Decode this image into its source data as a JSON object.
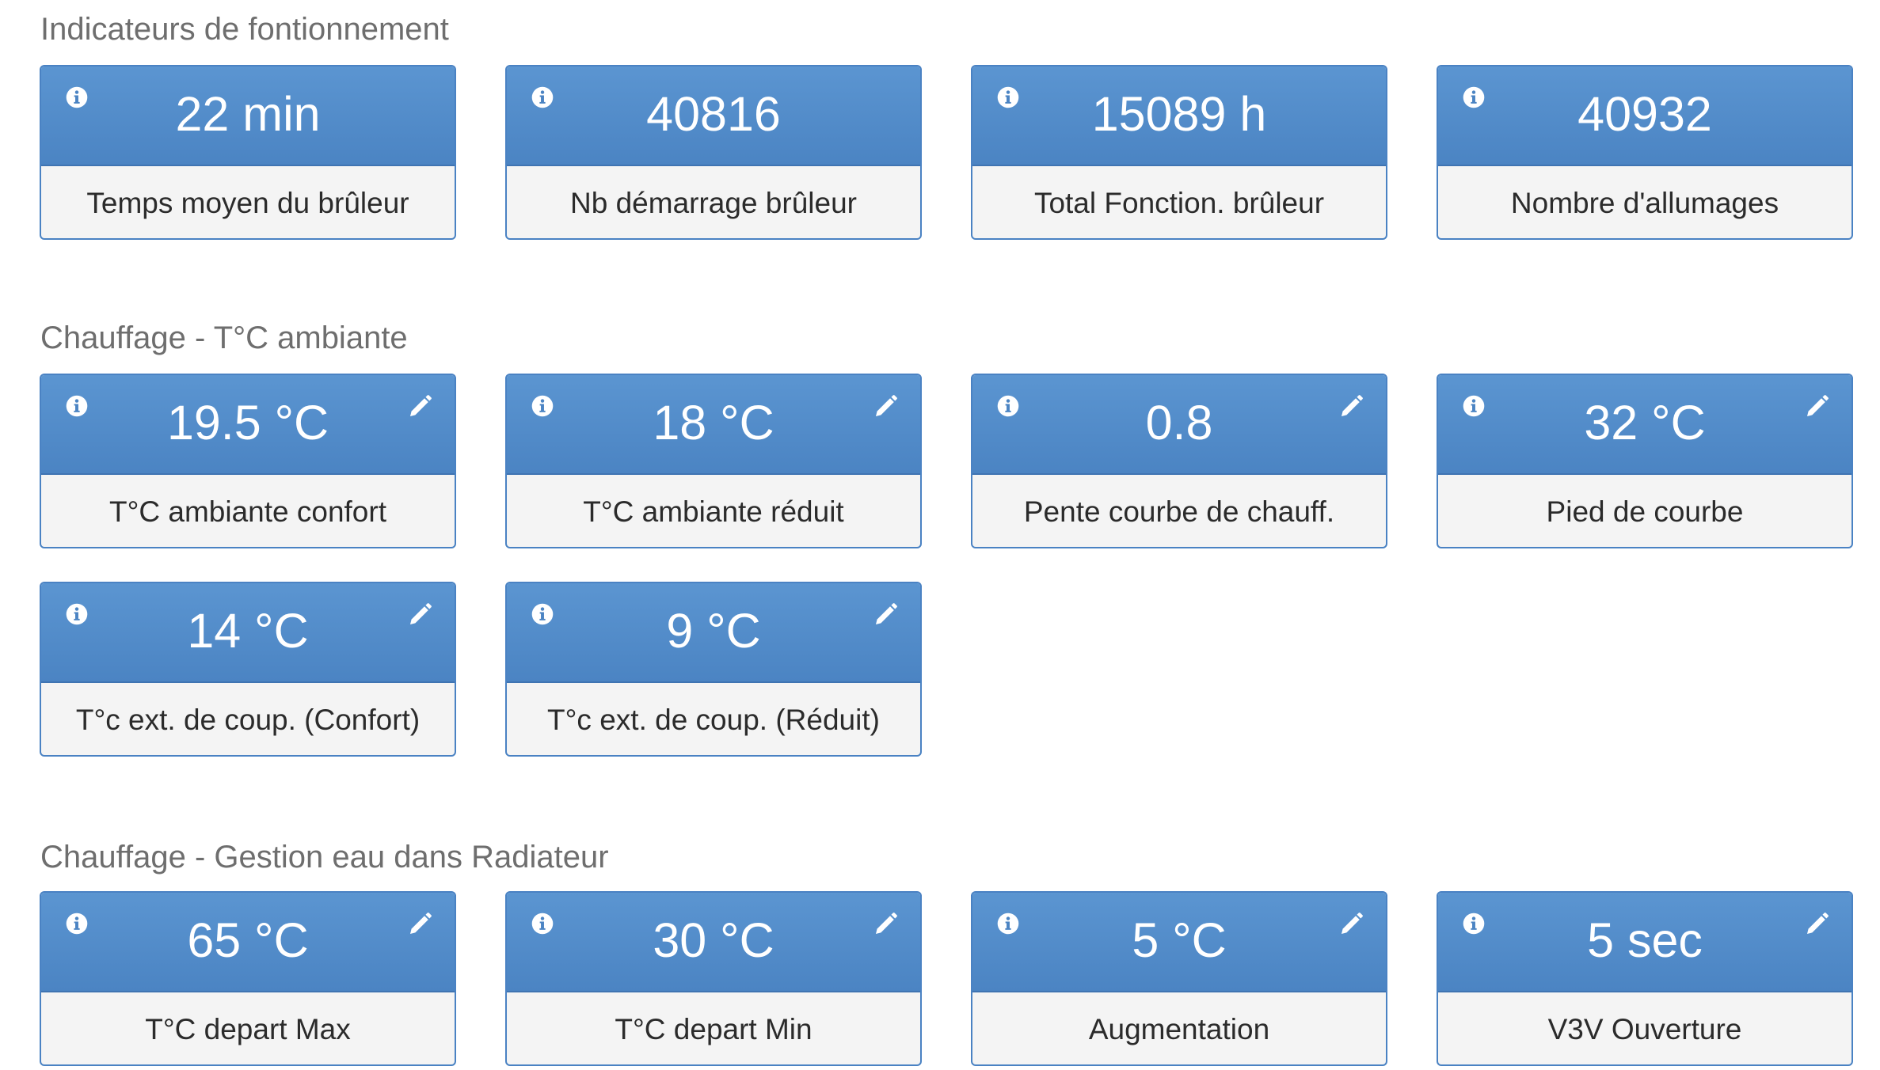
{
  "sections": [
    {
      "title": "Indicateurs de fontionnement",
      "cards": [
        {
          "value": "22 min",
          "label": "Temps moyen du brûleur",
          "editable": false
        },
        {
          "value": "40816",
          "label": "Nb démarrage brûleur",
          "editable": false
        },
        {
          "value": "15089 h",
          "label": "Total Fonction. brûleur",
          "editable": false
        },
        {
          "value": "40932",
          "label": "Nombre d'allumages",
          "editable": false
        }
      ]
    },
    {
      "title": "Chauffage - T°C ambiante",
      "cards": [
        {
          "value": "19.5 °C",
          "label": "T°C ambiante confort",
          "editable": true
        },
        {
          "value": "18 °C",
          "label": "T°C ambiante réduit",
          "editable": true
        },
        {
          "value": "0.8",
          "label": "Pente courbe de chauff.",
          "editable": true
        },
        {
          "value": "32 °C",
          "label": "Pied de courbe",
          "editable": true
        },
        {
          "value": "14 °C",
          "label": "T°c ext. de coup. (Confort)",
          "editable": true
        },
        {
          "value": "9 °C",
          "label": "T°c ext. de coup. (Réduit)",
          "editable": true
        }
      ]
    },
    {
      "title": "Chauffage - Gestion eau dans Radiateur",
      "cards": [
        {
          "value": "65 °C",
          "label": "T°C depart Max",
          "editable": true
        },
        {
          "value": "30 °C",
          "label": "T°C depart Min",
          "editable": true
        },
        {
          "value": "5 °C",
          "label": "Augmentation",
          "editable": true
        },
        {
          "value": "5 sec",
          "label": "V3V Ouverture",
          "editable": true
        }
      ]
    }
  ],
  "icons": {
    "info": "info-icon",
    "edit": "pencil-icon"
  },
  "colors": {
    "card_header": "#5288c9",
    "card_border": "#4a82c3",
    "card_body": "#f4f4f4",
    "section_title": "#6e6e6e"
  }
}
